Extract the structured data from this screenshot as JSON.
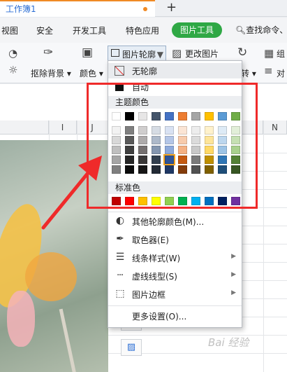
{
  "tab": {
    "title": "工作簿1"
  },
  "menubar": {
    "items": [
      "视图",
      "安全",
      "开发工具",
      "特色应用"
    ],
    "active": "图片工具",
    "search": "查找命令、"
  },
  "ribbon": {
    "remove_bg": "抠除背景",
    "color": "颜色",
    "outline": "图片轮廓",
    "change_pic": "更改图片",
    "rotate": "转",
    "group1": "组",
    "align": "对"
  },
  "sheet": {
    "col_i": "I",
    "col_j": "J",
    "col_n": "N"
  },
  "dropdown": {
    "no_outline": "无轮廓",
    "auto": "自动",
    "theme_title": "主题颜色",
    "theme_row": [
      "#ffffff",
      "#000000",
      "#e7e6e6",
      "#44546a",
      "#4472c4",
      "#ed7d31",
      "#a5a5a5",
      "#ffc000",
      "#5b9bd5",
      "#70ad47"
    ],
    "theme_shades": [
      [
        "#f2f2f2",
        "#7f7f7f",
        "#d0cece",
        "#d6dce4",
        "#d9e2f3",
        "#fbe5d5",
        "#ededed",
        "#fff2cc",
        "#deebf6",
        "#e2efd9"
      ],
      [
        "#d8d8d8",
        "#595959",
        "#aeabab",
        "#adb9ca",
        "#b4c6e7",
        "#f7cbac",
        "#dbdbdb",
        "#fee599",
        "#bdd7ee",
        "#c5e0b3"
      ],
      [
        "#bfbfbf",
        "#3f3f3f",
        "#757070",
        "#8496b0",
        "#8eaadb",
        "#f4b183",
        "#c9c9c9",
        "#ffd966",
        "#9cc3e5",
        "#a8d08d"
      ],
      [
        "#a5a5a5",
        "#262626",
        "#3a3838",
        "#323f4f",
        "#2f5496",
        "#c55a11",
        "#7b7b7b",
        "#bf9000",
        "#2e75b5",
        "#538135"
      ],
      [
        "#7f7f7f",
        "#0c0c0c",
        "#171616",
        "#222a35",
        "#1f3864",
        "#833c0b",
        "#525252",
        "#7f6000",
        "#1e4e79",
        "#375623"
      ]
    ],
    "standard_title": "标准色",
    "standard_colors": [
      "#c00000",
      "#ff0000",
      "#ffc000",
      "#ffff00",
      "#92d050",
      "#00b050",
      "#00b0f0",
      "#0070c0",
      "#002060",
      "#7030a0"
    ],
    "more_colors": "其他轮廓颜色(M)...",
    "eyedropper": "取色器(E)",
    "line_style": "线条样式(W)",
    "dash_type": "虚线线型(S)",
    "picture_border": "图片边框",
    "more_settings": "更多设置(O)..."
  },
  "watermark": "Bai 经验"
}
